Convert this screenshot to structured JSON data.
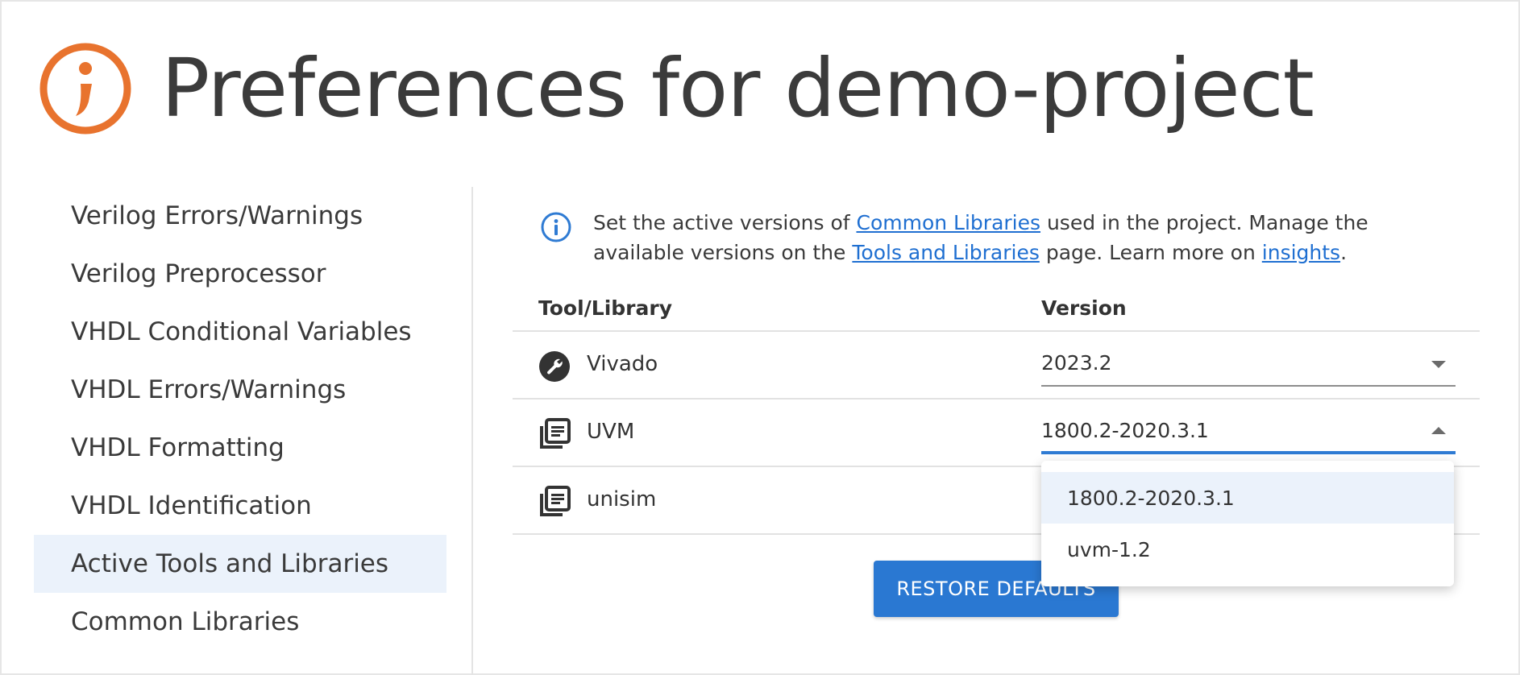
{
  "header": {
    "title": "Preferences for demo-project",
    "logo_icon": "brand-logo-icon",
    "accent_color": "#e8732e"
  },
  "sidebar": {
    "items": [
      {
        "label": "Verilog Errors/Warnings",
        "active": false
      },
      {
        "label": "Verilog Preprocessor",
        "active": false
      },
      {
        "label": "VHDL Conditional Variables",
        "active": false
      },
      {
        "label": "VHDL Errors/Warnings",
        "active": false
      },
      {
        "label": "VHDL Formatting",
        "active": false
      },
      {
        "label": "VHDL Identification",
        "active": false
      },
      {
        "label": "Active Tools and Libraries",
        "active": true
      },
      {
        "label": "Common Libraries",
        "active": false
      }
    ]
  },
  "info": {
    "text_1": "Set the active versions of ",
    "link_1": "Common Libraries",
    "text_2": " used in the project. Manage the available versions on the ",
    "link_2": "Tools and Libraries",
    "text_3": " page. Learn more on ",
    "link_3": "insights",
    "text_4": "."
  },
  "table": {
    "headers": {
      "tool": "Tool/Library",
      "version": "Version"
    },
    "rows": [
      {
        "icon": "wrench-icon",
        "name": "Vivado",
        "version": "2023.2",
        "open": false
      },
      {
        "icon": "library-icon",
        "name": "UVM",
        "version": "1800.2-2020.3.1",
        "open": true
      },
      {
        "icon": "library-icon",
        "name": "unisim",
        "version": "",
        "open": false
      }
    ]
  },
  "dropdown": {
    "options": [
      {
        "label": "1800.2-2020.3.1",
        "selected": true
      },
      {
        "label": "uvm-1.2",
        "selected": false
      }
    ]
  },
  "actions": {
    "restore_label": "RESTORE DEFAULTS",
    "primary_color": "#2a78d2"
  }
}
